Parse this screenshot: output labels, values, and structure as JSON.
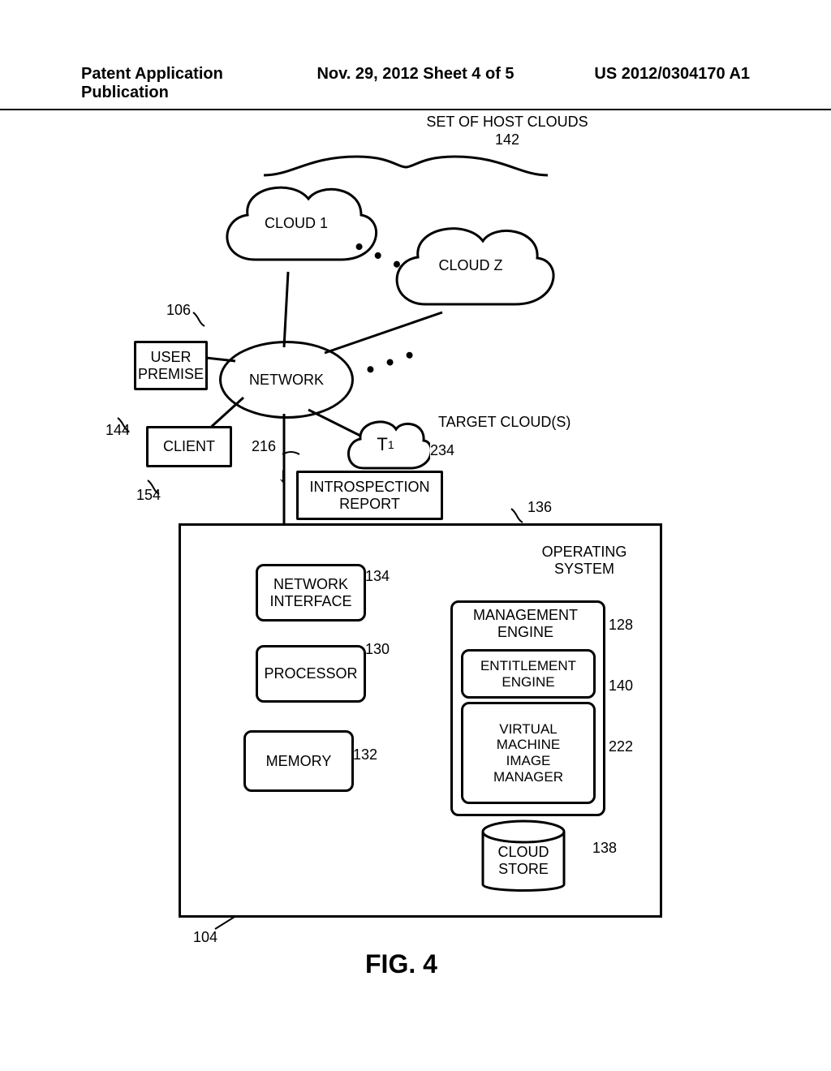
{
  "header": {
    "left": "Patent Application Publication",
    "center": "Nov. 29, 2012  Sheet 4 of 5",
    "right": "US 2012/0304170 A1"
  },
  "labels": {
    "set_of_host_clouds_title": "SET OF HOST CLOUDS",
    "set_of_host_clouds_num": "142",
    "cloud1": "CLOUD 1",
    "cloudz": "CLOUD Z",
    "network": "NETWORK",
    "user_premise": "USER\nPREMISE",
    "client": "CLIENT",
    "target_clouds": "TARGET CLOUD(S)",
    "t1": "T",
    "t1_sub": "1",
    "introspection_report": "INTROSPECTION\nREPORT",
    "operating_system": "OPERATING\nSYSTEM",
    "network_interface": "NETWORK\nINTERFACE",
    "processor": "PROCESSOR",
    "memory": "MEMORY",
    "management_engine": "MANAGEMENT\nENGINE",
    "entitlement_engine": "ENTITLEMENT\nENGINE",
    "vm_image_manager": "VIRTUAL\nMACHINE\nIMAGE\nMANAGER",
    "cloud_store": "CLOUD\nSTORE",
    "fig_title": "FIG. 4"
  },
  "nums": {
    "n106": "106",
    "n144": "144",
    "n154": "154",
    "n216": "216",
    "n234": "234",
    "n136": "136",
    "n134": "134",
    "n130": "130",
    "n132": "132",
    "n128": "128",
    "n140": "140",
    "n222": "222",
    "n138": "138",
    "n104": "104"
  }
}
